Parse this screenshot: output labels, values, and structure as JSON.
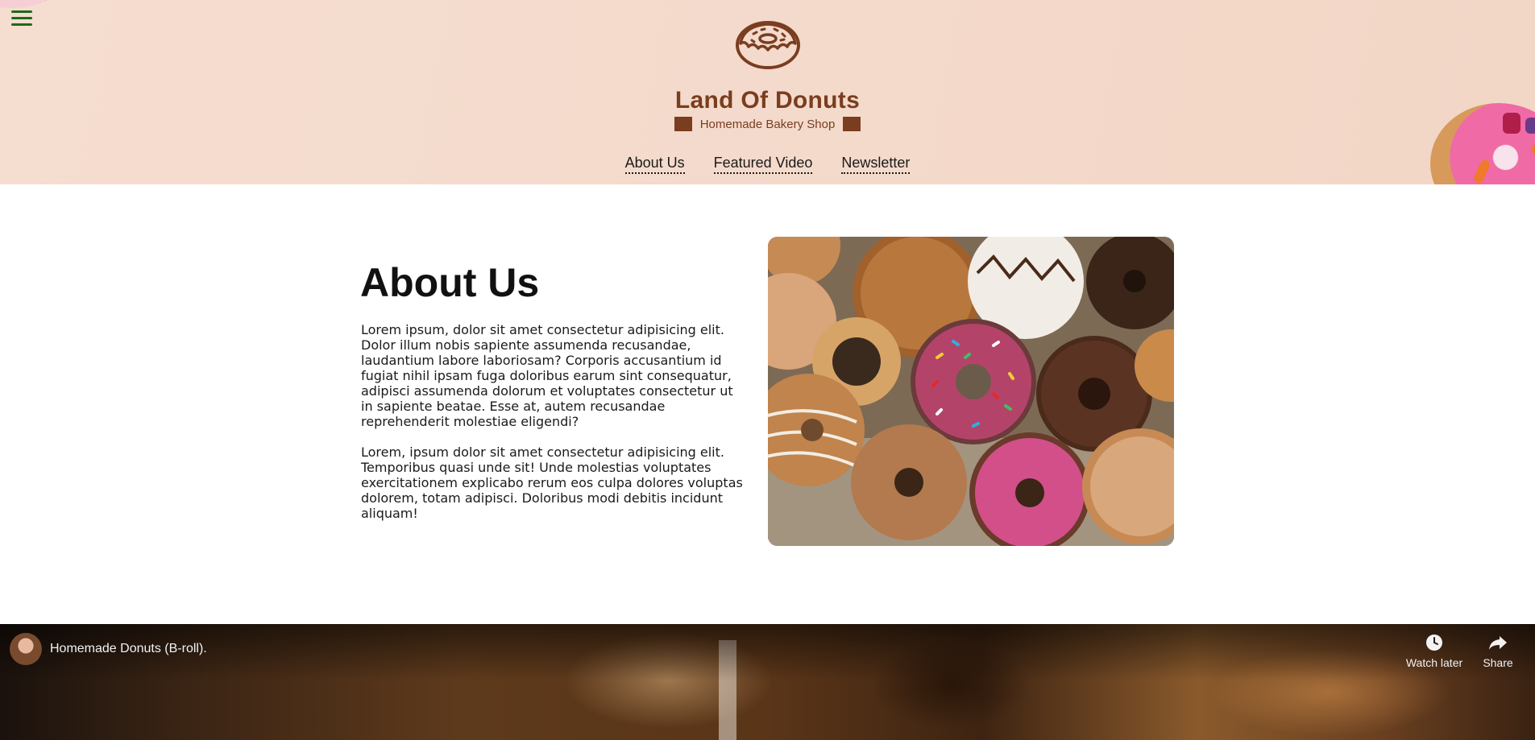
{
  "header": {
    "title": "Land Of Donuts",
    "tagline": "Homemade Bakery Shop",
    "logo_icon": "donut-icon",
    "menu_icon": "hamburger-menu-icon",
    "brand_color": "#7a3d1f"
  },
  "nav": {
    "items": [
      {
        "label": "About Us"
      },
      {
        "label": "Featured Video"
      },
      {
        "label": "Newsletter"
      }
    ]
  },
  "about": {
    "title": "About Us",
    "paragraph1": "Lorem ipsum, dolor sit amet consectetur adipisicing elit. Dolor illum nobis sapiente assumenda recusandae, laudantium labore laboriosam? Corporis accusantium id fugiat nihil ipsam fuga doloribus earum sint consequatur, adipisci assumenda dolorum et voluptates consectetur ut in sapiente beatae. Esse at, autem recusandae reprehenderit molestiae eligendi?",
    "paragraph2": "Lorem, ipsum dolor sit amet consectetur adipisicing elit. Temporibus quasi unde sit! Unde molestias voluptates exercitationem explicabo rerum eos culpa dolores voluptas dolorem, totam adipisci. Doloribus modi debitis incidunt aliquam!"
  },
  "video": {
    "title": "Homemade Donuts (B-roll).",
    "watch_later": "Watch later",
    "share": "Share",
    "watch_later_icon": "clock-icon",
    "share_icon": "share-arrow-icon"
  }
}
